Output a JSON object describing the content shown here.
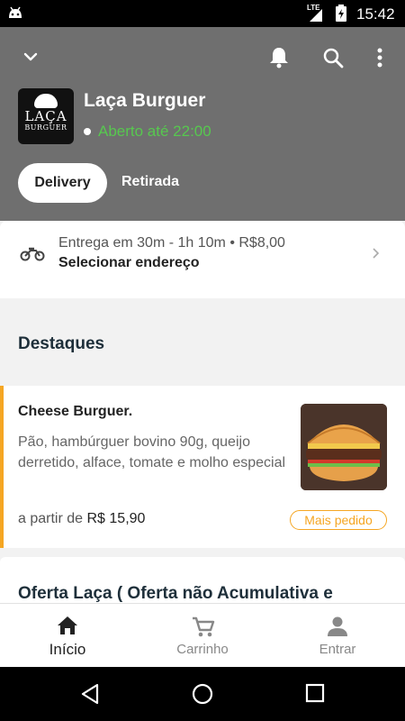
{
  "status_bar": {
    "network": "LTE",
    "time": "15:42"
  },
  "header": {
    "logo": {
      "line1": "LAÇA",
      "line2": "BURGUER"
    },
    "store_name": "Laça Burguer",
    "open_status": "Aberto até 22:00",
    "icons": [
      "chevron-down-icon",
      "bell-icon",
      "search-icon",
      "more-vert-icon"
    ],
    "tabs": [
      {
        "label": "Delivery",
        "selected": true
      },
      {
        "label": "Retirada",
        "selected": false
      }
    ]
  },
  "delivery": {
    "info": "Entrega em 30m - 1h 10m • R$8,00",
    "address_action": "Selecionar endereço"
  },
  "highlights": {
    "title": "Destaques",
    "items": [
      {
        "name": "Cheese Burguer.",
        "description": "Pão, hambúrguer bovino 90g, queijo derretido, alface, tomate e molho especial",
        "price_prefix": "a partir de",
        "price": "R$ 15,90",
        "badge": "Mais pedido"
      }
    ]
  },
  "next_section": {
    "title": "Oferta Laça ( Oferta não Acumulativa e"
  },
  "bottom_nav": [
    {
      "label": "Início",
      "icon": "home-icon",
      "active": true
    },
    {
      "label": "Carrinho",
      "icon": "cart-icon",
      "active": false
    },
    {
      "label": "Entrar",
      "icon": "person-icon",
      "active": false
    }
  ],
  "colors": {
    "header_bg": "#6f6f6f",
    "open_green": "#57c84f",
    "accent_orange": "#f5a623"
  }
}
